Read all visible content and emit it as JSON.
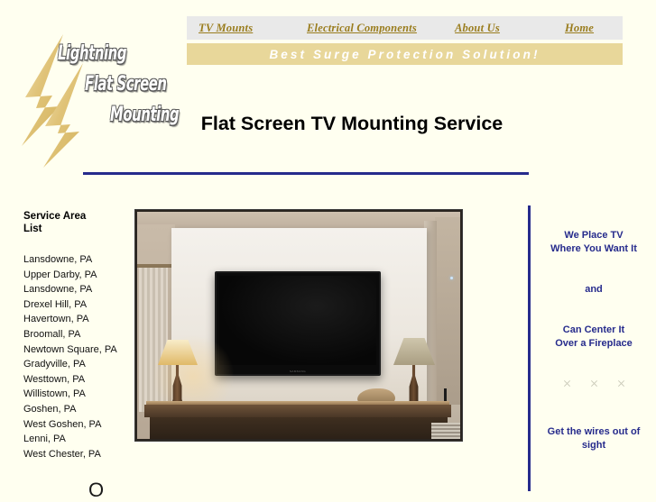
{
  "site": {
    "background_color": "#fffff0",
    "accent_navy": "#262b8c",
    "accent_gold": "#9a7d1e",
    "nav_bar_color": "#e9e9e9",
    "tagline_bar_color": "#e8d79a"
  },
  "logo": {
    "line1": "Lightning",
    "line2": "Flat Screen",
    "line3": "Mounting",
    "icon": "lightning-bolt-icon"
  },
  "nav": {
    "items": [
      {
        "label": "TV Mounts"
      },
      {
        "label": "Electrical Components"
      },
      {
        "label": "About Us"
      },
      {
        "label": "Home"
      }
    ]
  },
  "tagline": {
    "text": "Best Surge Protection Solution!"
  },
  "header": {
    "title": "Flat Screen TV Mounting Service"
  },
  "left_column": {
    "heading": "Service Area\nList",
    "items": [
      "Lansdowne, PA",
      "Upper Darby, PA",
      "Lansdowne, PA",
      "Drexel Hill, PA",
      "Havertown, PA",
      "Broomall, PA",
      "Newtown Square, PA",
      "Gradyville, PA",
      "Westtown, PA",
      "Willistown, PA",
      "Goshen, PA",
      "West Goshen, PA",
      "Lenni, PA",
      "West Chester, PA"
    ],
    "cut_off_glyph": "O"
  },
  "main_photo": {
    "alt": "Flat screen TV mounted on white wall above a mantel with two table lamps",
    "tv_brand_label": "SAMSUNG"
  },
  "right_column": {
    "blocks": [
      "We Place TV\nWhere You Want It",
      "and",
      "Can Center It\nOver a Fireplace",
      "Get the wires out of\nsight"
    ],
    "broken_image_count": 3
  }
}
